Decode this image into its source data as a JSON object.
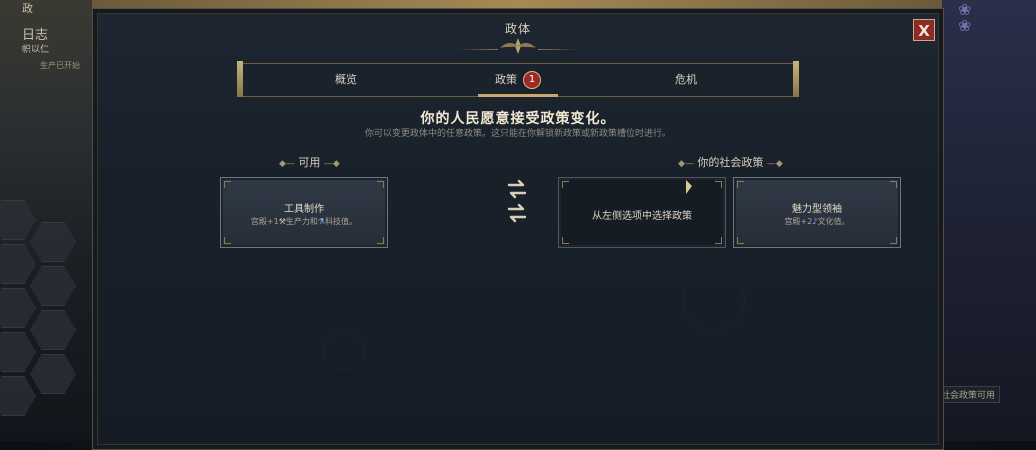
{
  "background": {
    "left_labels": [
      "政",
      "日志",
      "帜以仁",
      "生产已开始"
    ],
    "right_badge": "社会政策可用"
  },
  "modal": {
    "title": "政体",
    "close_label": "X",
    "tabs": [
      {
        "label": "概览"
      },
      {
        "label": "政策",
        "badge": "1"
      },
      {
        "label": "危机"
      }
    ],
    "headline": "你的人民愿意接受政策变化。",
    "subline": "你可以变更政体中的任意政策。这只能在你解锁新政策或新政策槽位时进行。",
    "available_label": "可用",
    "your_policies_label": "你的社会政策",
    "available_card": {
      "title": "工具制作",
      "desc_a": "宫殿+1",
      "desc_b": "生产力和",
      "desc_c": "科技值。"
    },
    "empty_slot_text": "从左侧选项中选择政策",
    "policy_card": {
      "title": "魅力型领袖",
      "desc_a": "宫殿+2",
      "desc_b": "文化值。"
    }
  },
  "colors": {
    "accent_gold": "#c8a96a",
    "badge_red": "#9a2a23",
    "close_red": "#8b2b25"
  }
}
